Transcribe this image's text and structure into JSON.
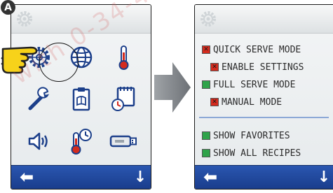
{
  "badge_label": "A",
  "watermark_text": "with 0-34-41 se.com",
  "home_screen": {
    "icons": [
      {
        "name": "gear-settings-icon",
        "highlighted": true
      },
      {
        "name": "globe-icon",
        "highlighted": false
      },
      {
        "name": "thermometer-icon",
        "highlighted": false
      },
      {
        "name": "wrench-icon",
        "highlighted": false
      },
      {
        "name": "clipboard-icon",
        "highlighted": false
      },
      {
        "name": "calendar-clock-icon",
        "highlighted": false
      },
      {
        "name": "speaker-volume-icon",
        "highlighted": false
      },
      {
        "name": "thermometer-clock-icon",
        "highlighted": false
      },
      {
        "name": "usb-drive-icon",
        "highlighted": false
      }
    ],
    "bottom_bar": {
      "back_icon": "back-arrow-icon",
      "down_icon": "down-arrow-icon"
    }
  },
  "settings_screen": {
    "menu": [
      {
        "label": "QUICK SERVE MODE",
        "state": "off",
        "color": "#d42b1e"
      },
      {
        "label": "ENABLE SETTINGS",
        "state": "off",
        "color": "#d42b1e"
      },
      {
        "label": "FULL SERVE MODE",
        "state": "on",
        "color": "#2fa34a"
      },
      {
        "label": "MANUAL MODE",
        "state": "off",
        "color": "#d42b1e"
      },
      {
        "label": "SHOW FAVORITES",
        "state": "on",
        "color": "#2fa34a"
      },
      {
        "label": "SHOW ALL RECIPES",
        "state": "on",
        "color": "#2fa34a"
      }
    ],
    "bottom_bar": {
      "back_icon": "back-arrow-icon",
      "down_icon": "down-arrow-icon"
    }
  },
  "colors": {
    "bottom_bar": "#1f4799",
    "off": "#d42b1e",
    "on": "#2fa34a",
    "hand": "#f7d21a"
  }
}
